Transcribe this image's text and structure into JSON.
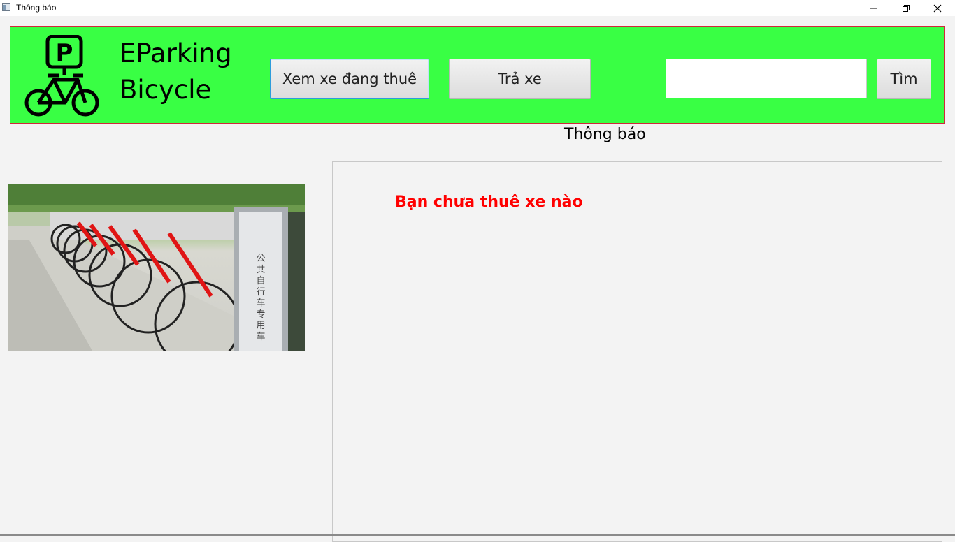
{
  "window": {
    "title": "Thông báo",
    "minimize_icon": "minimize-icon",
    "restore_icon": "restore-icon",
    "close_icon": "close-icon"
  },
  "header": {
    "background_color": "#39ff44",
    "border_color": "#d0273a",
    "logo_icon": "parking-bicycle-icon",
    "brand_line_1": "EParking",
    "brand_line_2": "Bicycle",
    "view_rented_label": "Xem xe đang thuê",
    "return_label": "Trả xe",
    "search_value": "",
    "find_label": "Tìm"
  },
  "main": {
    "notice_title": "Thông báo",
    "photo": "bicycle-rack-photo",
    "message": "Bạn chưa thuê xe nào",
    "message_color": "#ff0000"
  }
}
